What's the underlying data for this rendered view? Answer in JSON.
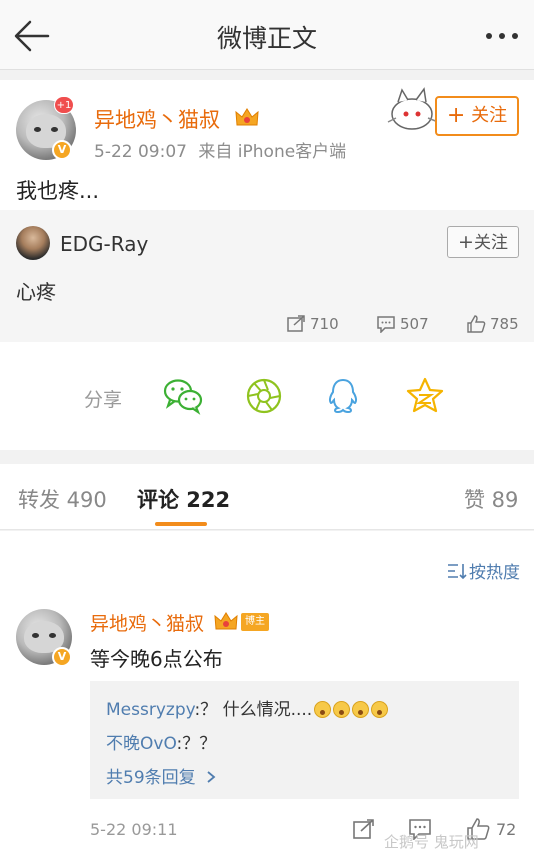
{
  "header": {
    "title": "微博正文",
    "back_icon": "back-arrow-icon",
    "more_icon": "more-dots-icon"
  },
  "post": {
    "author": "异地鸡丶猫叔",
    "notification_badge": "+1",
    "verified_mark": "V",
    "timestamp": "5-22 09:07",
    "source": "来自 iPhone客户端",
    "text": "我也疼...",
    "follow_label": "关注"
  },
  "repost": {
    "author": "EDG-Ray",
    "follow_label": "关注",
    "text": "心疼",
    "stats": {
      "reposts": "710",
      "comments": "507",
      "likes": "785"
    }
  },
  "share": {
    "label": "分享",
    "icons": [
      "wechat-icon",
      "moments-icon",
      "qq-icon",
      "qzone-icon"
    ],
    "colors": {
      "wechat": "#3cb034",
      "moments": "#8fc31f",
      "qq": "#4aa3df",
      "qzone": "#f5b400"
    }
  },
  "tabs": {
    "repost_label": "转发 490",
    "comment_label": "评论 222",
    "like_label": "赞 89",
    "active": "comments"
  },
  "comments": {
    "sort_label": "按热度",
    "items": [
      {
        "author": "异地鸡丶猫叔",
        "badge": "博主",
        "text": "等今晚6点公布",
        "replies": [
          {
            "user": "Messryzpy",
            "text": ":？ 什么情况....",
            "emoji_count": 4
          },
          {
            "user": "不晚OvO",
            "text": ":？？"
          }
        ],
        "more_replies": "共59条回复",
        "time": "5-22 09:11",
        "likes": "72"
      }
    ]
  },
  "watermark": "企鹅号 鬼玩网",
  "colors": {
    "accent": "#f28c1b",
    "username": "#e86b0c",
    "link": "#507daf"
  }
}
